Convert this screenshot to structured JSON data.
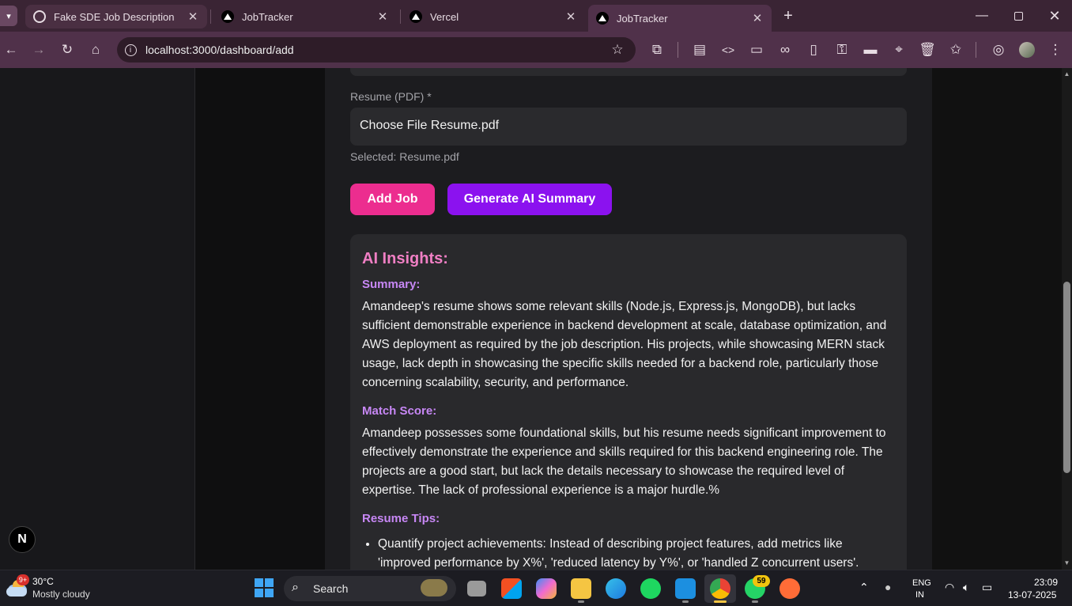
{
  "browser": {
    "tabs": [
      {
        "title": "Fake SDE Job Description",
        "icon": "chatgpt-icon"
      },
      {
        "title": "JobTracker",
        "icon": "vercel-triangle-icon"
      },
      {
        "title": "Vercel",
        "icon": "vercel-triangle-icon"
      },
      {
        "title": "JobTracker",
        "icon": "vercel-triangle-icon",
        "active": true
      }
    ],
    "url": "localhost:3000/dashboard/add"
  },
  "form": {
    "resume_label": "Resume (PDF) *",
    "file_input_text": "Choose File Resume.pdf",
    "selected_text": "Selected: Resume.pdf",
    "add_job_label": "Add Job",
    "generate_label": "Generate AI Summary"
  },
  "insights": {
    "title": "AI Insights:",
    "summary_heading": "Summary:",
    "summary_text": "Amandeep's resume shows some relevant skills (Node.js, Express.js, MongoDB), but lacks sufficient demonstrable experience in backend development at scale, database optimization, and AWS deployment as required by the job description. His projects, while showcasing MERN stack usage, lack depth in showcasing the specific skills needed for a backend role, particularly those concerning scalability, security, and performance.",
    "match_heading": "Match Score:",
    "match_text": "Amandeep possesses some foundational skills, but his resume needs significant improvement to effectively demonstrate the experience and skills required for this backend engineering role. The projects are a good start, but lack the details necessary to showcase the required level of expertise. The lack of professional experience is a major hurdle.%",
    "tips_heading": "Resume Tips:",
    "tips": [
      "Quantify project achievements: Instead of describing project features, add metrics like 'improved performance by X%', 'reduced latency by Y%', or 'handled Z concurrent users'."
    ]
  },
  "next_badge": "N",
  "taskbar": {
    "weather_temp": "30°C",
    "weather_desc": "Mostly cloudy",
    "weather_badge": "9+",
    "search_label": "Search",
    "whatsapp_badge": "59",
    "lang_line1": "ENG",
    "lang_line2": "IN",
    "time": "23:09",
    "date": "13-07-2025"
  },
  "colors": {
    "add_job": "#ec2d8f",
    "generate": "#8b12ef",
    "insights_title": "#f07fc4",
    "section_heading": "#c787f5"
  }
}
